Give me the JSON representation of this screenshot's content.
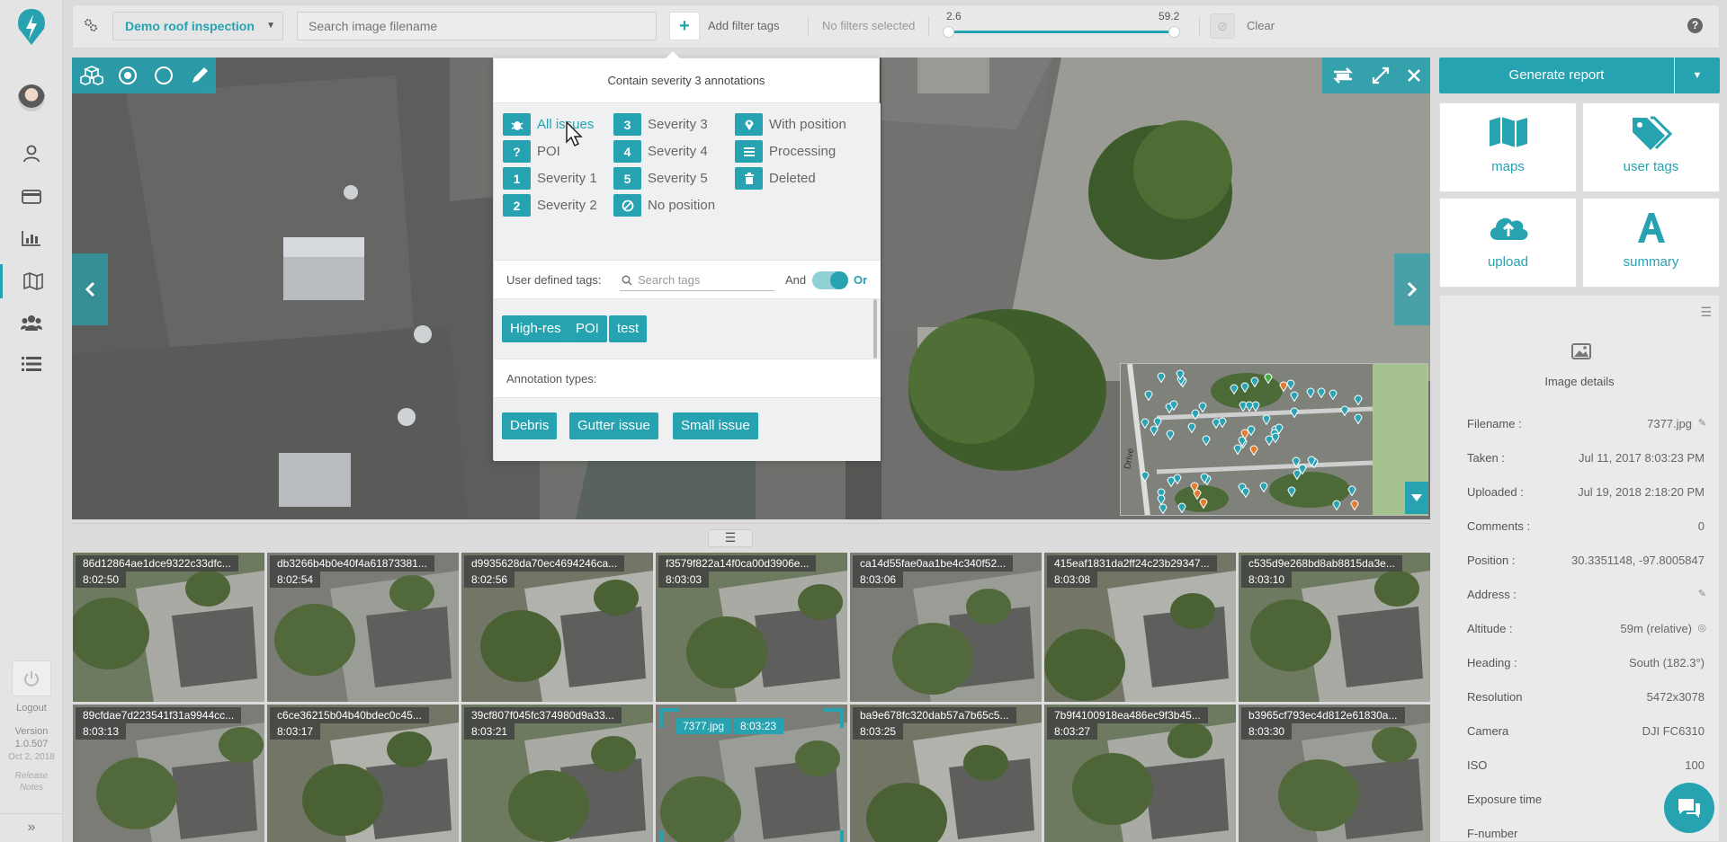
{
  "topbar": {
    "project": "Demo roof inspection",
    "search_placeholder": "Search image filename",
    "add_filter_tags": "Add filter tags",
    "no_filters": "No filters selected",
    "slider_min": "2.6",
    "slider_max": "59.2",
    "clear": "Clear"
  },
  "leftnav": {
    "logout": "Logout",
    "version_label": "Version",
    "version": "1.0.507",
    "date": "Oct 2, 2018",
    "release_notes": "Release Notes"
  },
  "filter_dropdown": {
    "title": "Contain severity 3 annotations",
    "items": [
      {
        "icon": "bug-icon",
        "badge": "",
        "label": "All issues"
      },
      {
        "icon": "question-icon",
        "badge": "?",
        "label": "POI"
      },
      {
        "icon": "number-1",
        "badge": "1",
        "label": "Severity 1"
      },
      {
        "icon": "number-2",
        "badge": "2",
        "label": "Severity 2"
      },
      {
        "icon": "number-3",
        "badge": "3",
        "label": "Severity 3"
      },
      {
        "icon": "number-4",
        "badge": "4",
        "label": "Severity 4"
      },
      {
        "icon": "number-5",
        "badge": "5",
        "label": "Severity 5"
      },
      {
        "icon": "ban-icon",
        "badge": "",
        "label": "No position"
      },
      {
        "icon": "map-pin-icon",
        "badge": "",
        "label": "With position"
      },
      {
        "icon": "processing-icon",
        "badge": "",
        "label": "Processing"
      },
      {
        "icon": "trash-icon",
        "badge": "",
        "label": "Deleted"
      }
    ],
    "user_defined_tags_label": "User defined tags:",
    "tag_search_placeholder": "Search tags",
    "and_label": "And",
    "or_label": "Or",
    "user_tags": [
      "High-res",
      "POI",
      "test"
    ],
    "annotation_types_label": "Annotation types:",
    "annotation_types": [
      "Debris",
      "Gutter issue",
      "Small issue"
    ]
  },
  "minimap": {
    "street_label": "Drive"
  },
  "thumbnails": [
    {
      "name": "86d12864ae1dce9322c33dfc...",
      "time": "8:02:50"
    },
    {
      "name": "db3266b4b0e40f4a61873381...",
      "time": "8:02:54"
    },
    {
      "name": "d9935628da70ec4694246ca...",
      "time": "8:02:56"
    },
    {
      "name": "f3579f822a14f0ca00d3906e...",
      "time": "8:03:03"
    },
    {
      "name": "ca14d55fae0aa1be4c340f52...",
      "time": "8:03:06"
    },
    {
      "name": "415eaf1831da2ff24c23b29347...",
      "time": "8:03:08"
    },
    {
      "name": "c535d9e268bd8ab8815da3e...",
      "time": "8:03:10"
    },
    {
      "name": "89cfdae7d223541f31a9944cc...",
      "time": "8:03:13"
    },
    {
      "name": "c6ce36215b04b40bdec0c45...",
      "time": "8:03:17"
    },
    {
      "name": "39cf807f045fc374980d9a33...",
      "time": "8:03:21"
    },
    {
      "name": "7377.jpg",
      "time": "8:03:23",
      "selected": true
    },
    {
      "name": "ba9e678fc320dab57a7b65c5...",
      "time": "8:03:25"
    },
    {
      "name": "7b9f4100918ea486ec9f3b45...",
      "time": "8:03:27"
    },
    {
      "name": "b3965cf793ec4d812e61830a...",
      "time": "8:03:30"
    }
  ],
  "right": {
    "generate_report": "Generate report",
    "tiles": [
      {
        "label": "maps",
        "icon": "map-icon"
      },
      {
        "label": "user tags",
        "icon": "tags-icon"
      },
      {
        "label": "upload",
        "icon": "cloud-upload-icon"
      },
      {
        "label": "summary",
        "icon": "font-a-icon"
      }
    ],
    "details_title": "Image details",
    "details": [
      {
        "k": "Filename :",
        "v": "7377.jpg"
      },
      {
        "k": "Taken :",
        "v": "Jul 11, 2017 8:03:23 PM"
      },
      {
        "k": "Uploaded :",
        "v": "Jul 19, 2018 2:18:20 PM"
      },
      {
        "k": "Comments :",
        "v": "0"
      },
      {
        "k": "Position :",
        "v": "30.3351148, -97.8005847"
      },
      {
        "k": "Address :",
        "v": ""
      },
      {
        "k": "Altitude :",
        "v": "59m (relative)"
      },
      {
        "k": "Heading :",
        "v": "South (182.3°)"
      },
      {
        "k": "Resolution",
        "v": "5472x3078"
      },
      {
        "k": "Camera",
        "v": "DJI FC6310"
      },
      {
        "k": "ISO",
        "v": "100"
      },
      {
        "k": "Exposure time",
        "v": ""
      },
      {
        "k": "F-number",
        "v": ""
      }
    ]
  },
  "colors": {
    "accent": "#26a2b0"
  }
}
